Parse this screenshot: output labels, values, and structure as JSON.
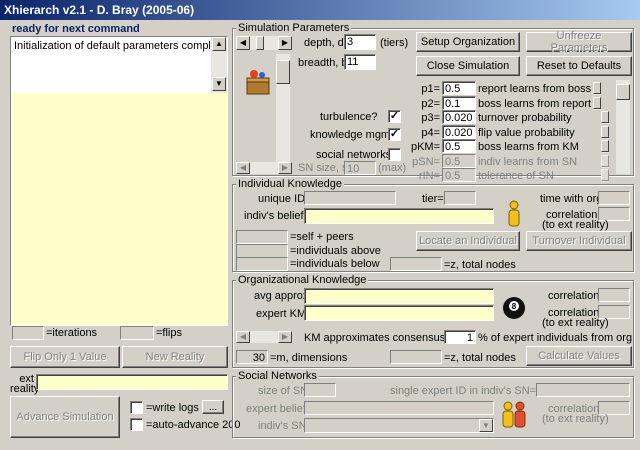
{
  "window": {
    "title": "Xhierarch v2.1 - D. Bray (2005-06)"
  },
  "status": {
    "label": "ready for next command",
    "log_text": "Initialization of default parameters complete"
  },
  "counters": {
    "iterations_value": "",
    "iterations_label": "=iterations",
    "flips_value": "",
    "flips_label": "=flips"
  },
  "left_buttons": {
    "flip_only": "Flip Only 1 Value",
    "new_reality": "New Reality",
    "advance": "Advance Simulation",
    "ellipsis": "..."
  },
  "ext_reality": {
    "label_line1": "ext",
    "label_line2": "reality",
    "value": ""
  },
  "options": {
    "write_logs": "=write logs",
    "auto_advance": "=auto-advance 200",
    "write_logs_checked": false,
    "auto_advance_checked": false
  },
  "sim": {
    "title": "Simulation Parameters",
    "depth_label": "depth, d=",
    "depth_value": "3",
    "depth_unit": "(tiers)",
    "breadth_label": "breadth, b=",
    "breadth_value": "11",
    "turbulence_label": "turbulence?",
    "turbulence_checked": true,
    "knowledge_label": "knowledge mgmt?",
    "knowledge_checked": true,
    "social_label": "social networks?",
    "social_checked": false,
    "sn_size_label": "SN size, s=",
    "sn_size_value": "10",
    "sn_size_unit": "(max)",
    "setup_btn": "Setup Organization",
    "unfreeze_btn": "Unfreeze Parameters",
    "close_btn": "Close Simulation",
    "reset_btn": "Reset to Defaults",
    "params": [
      {
        "label": "p1=",
        "value": "0.5",
        "desc": "report learns from boss",
        "enabled": true
      },
      {
        "label": "p2=",
        "value": "0.1",
        "desc": "boss learns from report",
        "enabled": true
      },
      {
        "label": "p3=",
        "value": "0.020",
        "desc": "turnover probability",
        "enabled": true
      },
      {
        "label": "p4=",
        "value": "0.020",
        "desc": "flip value probability",
        "enabled": true
      },
      {
        "label": "pKM=",
        "value": "0.5",
        "desc": "boss learns from KM",
        "enabled": true
      },
      {
        "label": "pSN=",
        "value": "0.5",
        "desc": "indiv learns from SN",
        "enabled": false
      },
      {
        "label": "rIN=",
        "value": "0.5",
        "desc": "tolerance of SN",
        "enabled": false
      }
    ]
  },
  "indiv": {
    "title": "Individual Knowledge",
    "unique_id_label": "unique ID=",
    "tier_label": "tier=",
    "time_label": "time with org=",
    "beliefs_label": "indiv's beliefs=",
    "correlation_label": "correlation=",
    "correlation_sub": "(to ext reality)",
    "self_peers": "=self + peers",
    "above": "=individuals above",
    "below": "=individuals below",
    "locate_btn": "Locate an Individual",
    "turnover_btn": "Turnover Individual",
    "total_nodes": "=z, total nodes"
  },
  "org": {
    "title": "Organizational Knowledge",
    "avg_label": "avg approx=",
    "expert_label": "expert KM=",
    "correlation_label": "correlation=",
    "correlation_sub": "(to ext reality)",
    "km_label": "KM approximates consensus, rEX=",
    "km_value": "1",
    "km_suffix": "% of expert individuals from org",
    "dimensions_value": "30",
    "dimensions_label": "=m, dimensions",
    "total_nodes": "=z, total nodes",
    "calc_btn": "Calculate Values"
  },
  "sn": {
    "title": "Social Networks",
    "size_label": "size of SN=",
    "single_label": "single expert ID in indiv's SN=",
    "expert_beliefs_label": "expert beliefs=",
    "indivs_sn_label": "indiv's SN=",
    "correlation_label": "correlation=",
    "correlation_sub": "(to ext reality)"
  },
  "icons": {
    "pieces": "chess-pieces-icon",
    "person": "person-icon",
    "eightball": "eight-ball-icon",
    "people": "people-icon"
  }
}
